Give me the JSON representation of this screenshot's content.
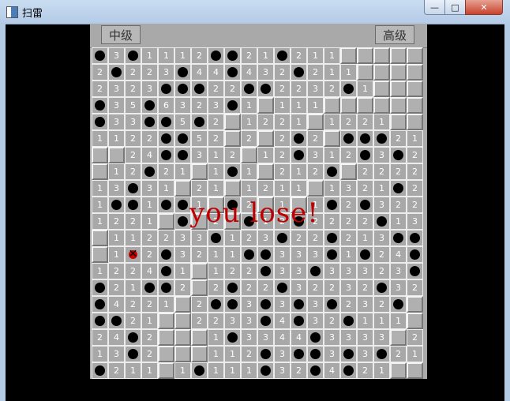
{
  "window": {
    "title": "扫雷",
    "close_glyph": "✕",
    "maximize_glyph": "□",
    "minimize_glyph": "—"
  },
  "game": {
    "left_button": "中级",
    "right_button": "高级",
    "status_message": "you lose!"
  },
  "board": {
    "cols": 20,
    "rows": [
      "M3M1112MM21M211.....",
      "2M223M44M432M211.....",
      "2323MMM22MM2232M1....",
      "M35M6323M1.111.....",
      "M33MM5M2.1221.1221.",
      "1122MM52.2.2M2.MMM21",
      "..24MM312.12M312M3M2",
      ".12M21.1M1.212M.2222",
      "13M31.21.1211.1321M2",
      "1MM1MM1.M2.1.1M2M322",
      "1221.M.2.M12M2222M13M",
      ".112233M123M22M213MM",
      ".1X2M3211MM333M1M24M",
      "1224M1.122M33M33323M",
      "M21MM2.2M22M32232M32",
      "M4221.2MM3M3M3M232M",
      "MM21..2233M4M32M111",
      "24M2...1M3344M3333.2",
      "13M2...112M3MM3M3M21",
      "M211.1M111M32M4M21.."
    ]
  }
}
